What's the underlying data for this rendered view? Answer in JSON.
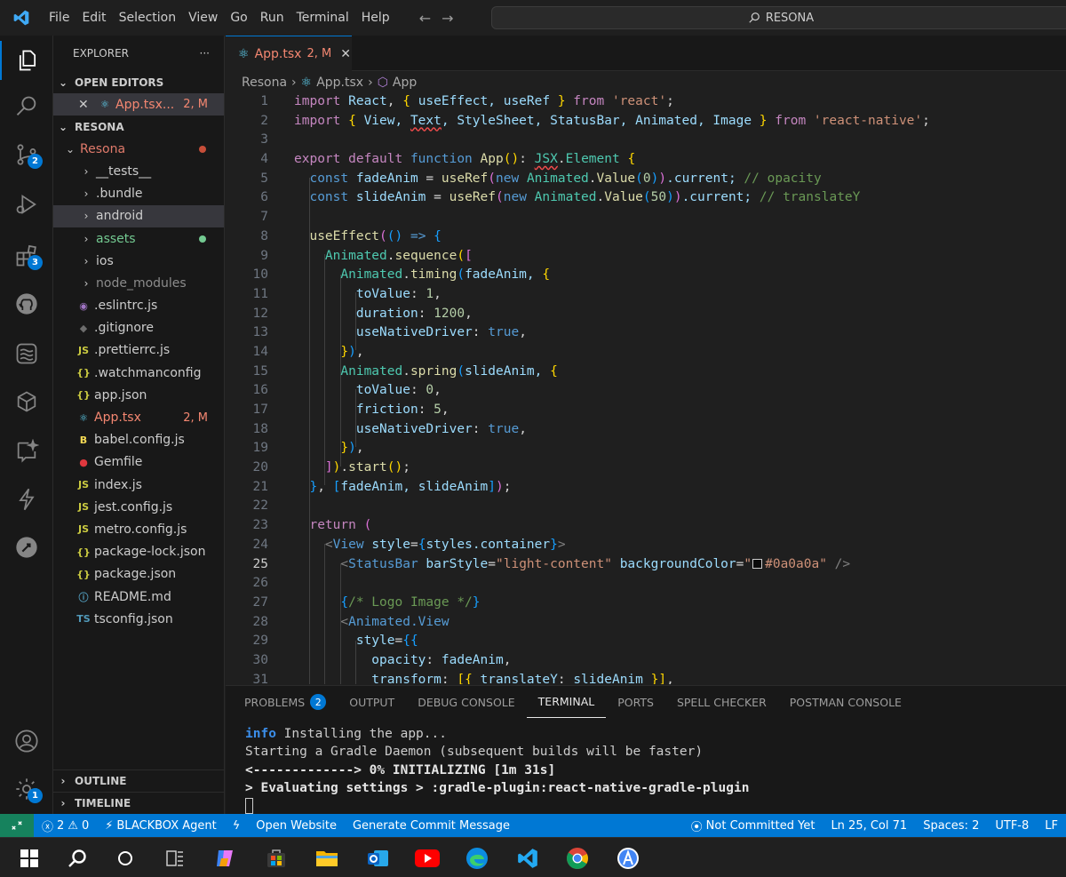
{
  "menu": [
    "File",
    "Edit",
    "Selection",
    "View",
    "Go",
    "Run",
    "Terminal",
    "Help"
  ],
  "search": {
    "text": "RESONA"
  },
  "activity": {
    "source_control_badge": "2",
    "extensions_badge": "3",
    "accounts_badge": "1"
  },
  "sidebar": {
    "title": "EXPLORER",
    "more": "···",
    "open_editors": {
      "label": "OPEN EDITORS",
      "item": {
        "name": "App.tsx...",
        "status": "2, M"
      }
    },
    "workspace": "RESONA",
    "root": {
      "name": "Resona"
    },
    "items": [
      {
        "name": "__tests__",
        "kind": "folder"
      },
      {
        "name": ".bundle",
        "kind": "folder"
      },
      {
        "name": "android",
        "kind": "folder"
      },
      {
        "name": "assets",
        "kind": "folder"
      },
      {
        "name": "ios",
        "kind": "folder"
      },
      {
        "name": "node_modules",
        "kind": "folder"
      },
      {
        "name": ".eslintrc.js",
        "kind": "eslint"
      },
      {
        "name": ".gitignore",
        "kind": "git"
      },
      {
        "name": ".prettierrc.js",
        "kind": "js"
      },
      {
        "name": ".watchmanconfig",
        "kind": "json"
      },
      {
        "name": "app.json",
        "kind": "json"
      },
      {
        "name": "App.tsx",
        "kind": "react",
        "status": "2, M"
      },
      {
        "name": "babel.config.js",
        "kind": "babel"
      },
      {
        "name": "Gemfile",
        "kind": "ruby"
      },
      {
        "name": "index.js",
        "kind": "js"
      },
      {
        "name": "jest.config.js",
        "kind": "js"
      },
      {
        "name": "metro.config.js",
        "kind": "js"
      },
      {
        "name": "package-lock.json",
        "kind": "json"
      },
      {
        "name": "package.json",
        "kind": "json"
      },
      {
        "name": "README.md",
        "kind": "info"
      },
      {
        "name": "tsconfig.json",
        "kind": "ts"
      }
    ],
    "icon_glyphs": {
      "js": "JS",
      "json": "{}",
      "ts": "TS"
    },
    "outline": "OUTLINE",
    "timeline": "TIMELINE"
  },
  "editor": {
    "tab": {
      "name": "App.tsx",
      "status": "2, M"
    },
    "breadcrumb": [
      "Resona",
      "App.tsx",
      "App"
    ],
    "lines": [
      [
        [
          "import ",
          "kw2"
        ],
        [
          "React",
          "var"
        ],
        [
          ", ",
          "tx"
        ],
        [
          "{",
          "p1"
        ],
        [
          " useEffect, useRef ",
          "var"
        ],
        [
          "}",
          "p1"
        ],
        [
          " from ",
          "kw2"
        ],
        [
          "'react'",
          "str"
        ],
        [
          ";",
          "tx"
        ]
      ],
      [
        [
          "import ",
          "kw2"
        ],
        [
          "{",
          "p1"
        ],
        [
          " View, ",
          "var"
        ],
        [
          "Text",
          "var sq"
        ],
        [
          ", StyleSheet, StatusBar, Animated, Image ",
          "var"
        ],
        [
          "}",
          "p1"
        ],
        [
          " from ",
          "kw2"
        ],
        [
          "'react-native'",
          "str"
        ],
        [
          ";",
          "tx"
        ]
      ],
      [],
      [
        [
          "export ",
          "kw2"
        ],
        [
          "default ",
          "kw2"
        ],
        [
          "function ",
          "kw"
        ],
        [
          "App",
          "fn"
        ],
        [
          "()",
          "p1"
        ],
        [
          ": ",
          "tx"
        ],
        [
          "JSX",
          "cls sq"
        ],
        [
          ".",
          "tx"
        ],
        [
          "Element",
          "cls"
        ],
        [
          " {",
          "p1"
        ]
      ],
      [
        [
          "  const ",
          "kw"
        ],
        [
          "fadeAnim",
          "var"
        ],
        [
          " = ",
          "tx"
        ],
        [
          "useRef",
          "fn"
        ],
        [
          "(",
          "p2"
        ],
        [
          "new ",
          "kw"
        ],
        [
          "Animated",
          "cls"
        ],
        [
          ".",
          "tx"
        ],
        [
          "Value",
          "fn"
        ],
        [
          "(",
          "p3"
        ],
        [
          "0",
          "num"
        ],
        [
          ")",
          "p3"
        ],
        [
          ")",
          "p2"
        ],
        [
          ".current; ",
          "var"
        ],
        [
          "// opacity",
          "cm"
        ]
      ],
      [
        [
          "  const ",
          "kw"
        ],
        [
          "slideAnim",
          "var"
        ],
        [
          " = ",
          "tx"
        ],
        [
          "useRef",
          "fn"
        ],
        [
          "(",
          "p2"
        ],
        [
          "new ",
          "kw"
        ],
        [
          "Animated",
          "cls"
        ],
        [
          ".",
          "tx"
        ],
        [
          "Value",
          "fn"
        ],
        [
          "(",
          "p3"
        ],
        [
          "50",
          "num"
        ],
        [
          ")",
          "p3"
        ],
        [
          ")",
          "p2"
        ],
        [
          ".current; ",
          "var"
        ],
        [
          "// translateY",
          "cm"
        ]
      ],
      [],
      [
        [
          "  useEffect",
          "fn"
        ],
        [
          "(",
          "p2"
        ],
        [
          "() ",
          "p3"
        ],
        [
          "=> ",
          "kw"
        ],
        [
          "{",
          "p3"
        ]
      ],
      [
        [
          "    Animated",
          "cls"
        ],
        [
          ".",
          "tx"
        ],
        [
          "sequence",
          "fn"
        ],
        [
          "(",
          "p1"
        ],
        [
          "[",
          "p2"
        ]
      ],
      [
        [
          "      Animated",
          "cls"
        ],
        [
          ".",
          "tx"
        ],
        [
          "timing",
          "fn"
        ],
        [
          "(",
          "p3"
        ],
        [
          "fadeAnim, ",
          "var"
        ],
        [
          "{",
          "p1"
        ]
      ],
      [
        [
          "        toValue",
          "var"
        ],
        [
          ": ",
          "tx"
        ],
        [
          "1",
          "num"
        ],
        [
          ",",
          "tx"
        ]
      ],
      [
        [
          "        duration",
          "var"
        ],
        [
          ": ",
          "tx"
        ],
        [
          "1200",
          "num"
        ],
        [
          ",",
          "tx"
        ]
      ],
      [
        [
          "        useNativeDriver",
          "var"
        ],
        [
          ": ",
          "tx"
        ],
        [
          "true",
          "kw"
        ],
        [
          ",",
          "tx"
        ]
      ],
      [
        [
          "      }",
          "p1"
        ],
        [
          ")",
          "p3"
        ],
        [
          ",",
          "tx"
        ]
      ],
      [
        [
          "      Animated",
          "cls"
        ],
        [
          ".",
          "tx"
        ],
        [
          "spring",
          "fn"
        ],
        [
          "(",
          "p3"
        ],
        [
          "slideAnim, ",
          "var"
        ],
        [
          "{",
          "p1"
        ]
      ],
      [
        [
          "        toValue",
          "var"
        ],
        [
          ": ",
          "tx"
        ],
        [
          "0",
          "num"
        ],
        [
          ",",
          "tx"
        ]
      ],
      [
        [
          "        friction",
          "var"
        ],
        [
          ": ",
          "tx"
        ],
        [
          "5",
          "num"
        ],
        [
          ",",
          "tx"
        ]
      ],
      [
        [
          "        useNativeDriver",
          "var"
        ],
        [
          ": ",
          "tx"
        ],
        [
          "true",
          "kw"
        ],
        [
          ",",
          "tx"
        ]
      ],
      [
        [
          "      }",
          "p1"
        ],
        [
          ")",
          "p3"
        ],
        [
          ",",
          "tx"
        ]
      ],
      [
        [
          "    ]",
          "p2"
        ],
        [
          ")",
          "p1"
        ],
        [
          ".",
          "tx"
        ],
        [
          "start",
          "fn"
        ],
        [
          "()",
          "p1"
        ],
        [
          ";",
          "tx"
        ]
      ],
      [
        [
          "  }",
          "p3"
        ],
        [
          ", ",
          "tx"
        ],
        [
          "[",
          "p3"
        ],
        [
          "fadeAnim, slideAnim",
          "var"
        ],
        [
          "]",
          "p3"
        ],
        [
          ")",
          "p2"
        ],
        [
          ";",
          "tx"
        ]
      ],
      [],
      [
        [
          "  return ",
          "kw2"
        ],
        [
          "(",
          "p2"
        ]
      ],
      [
        [
          "    <",
          "gray"
        ],
        [
          "View ",
          "tag"
        ],
        [
          "style",
          "attr"
        ],
        [
          "=",
          "tx"
        ],
        [
          "{",
          "p3"
        ],
        [
          "styles.container",
          "var"
        ],
        [
          "}",
          "p3"
        ],
        [
          ">",
          "gray"
        ]
      ],
      [
        [
          "      <",
          "gray"
        ],
        [
          "StatusBar ",
          "tag"
        ],
        [
          "barStyle",
          "attr"
        ],
        [
          "=",
          "tx"
        ],
        [
          "\"light-content\" ",
          "str"
        ],
        [
          "backgroundColor",
          "attr"
        ],
        [
          "=",
          "tx"
        ],
        [
          "\"",
          "str"
        ],
        [
          "SWATCH",
          "sw"
        ],
        [
          "#0a0a0a\"",
          "str"
        ],
        [
          " />",
          "gray"
        ]
      ],
      [],
      [
        [
          "      {",
          "p3"
        ],
        [
          "/* Logo Image */",
          "cm"
        ],
        [
          "}",
          "p3"
        ]
      ],
      [
        [
          "      <",
          "gray"
        ],
        [
          "Animated.View",
          "tag"
        ]
      ],
      [
        [
          "        style",
          "attr"
        ],
        [
          "=",
          "tx"
        ],
        [
          "{{",
          "p3"
        ]
      ],
      [
        [
          "          opacity",
          "var"
        ],
        [
          ": ",
          "tx"
        ],
        [
          "fadeAnim",
          "var"
        ],
        [
          ",",
          "tx"
        ]
      ],
      [
        [
          "          transform",
          "var"
        ],
        [
          ": ",
          "tx"
        ],
        [
          "[{ ",
          "p1"
        ],
        [
          "translateY",
          "var"
        ],
        [
          ": ",
          "tx"
        ],
        [
          "slideAnim ",
          "var"
        ],
        [
          "}]",
          "p1"
        ],
        [
          ",",
          "tx"
        ]
      ]
    ],
    "current_line": 25
  },
  "panel": {
    "tabs": [
      {
        "label": "PROBLEMS",
        "badge": "2"
      },
      {
        "label": "OUTPUT"
      },
      {
        "label": "DEBUG CONSOLE"
      },
      {
        "label": "TERMINAL",
        "active": true
      },
      {
        "label": "PORTS"
      },
      {
        "label": "SPELL CHECKER"
      },
      {
        "label": "POSTMAN CONSOLE"
      }
    ],
    "terminal": {
      "info_label": "info",
      "line1": " Installing the app...",
      "line2": "Starting a Gradle Daemon (subsequent builds will be faster)",
      "line3": "<-------------> 0% INITIALIZING [1m 31s]",
      "line4": "> Evaluating settings > :gradle-plugin:react-native-gradle-plugin"
    }
  },
  "statusbar": {
    "errors": "2",
    "warnings": "0",
    "blackbox": "BLACKBOX Agent",
    "open_website": "Open Website",
    "commit_msg": "Generate Commit Message",
    "blame": "Not Committed Yet",
    "position": "Ln 25, Col 71",
    "spaces": "Spaces: 2",
    "encoding": "UTF-8",
    "eol": "LF"
  },
  "colors": {
    "accent": "#0078d4",
    "modified": "#e2c08d",
    "error_text": "#f48771",
    "git_dot_modified": "#c74e39",
    "git_dot_added": "#73c991",
    "folder_tsx": "#e07a6b"
  }
}
